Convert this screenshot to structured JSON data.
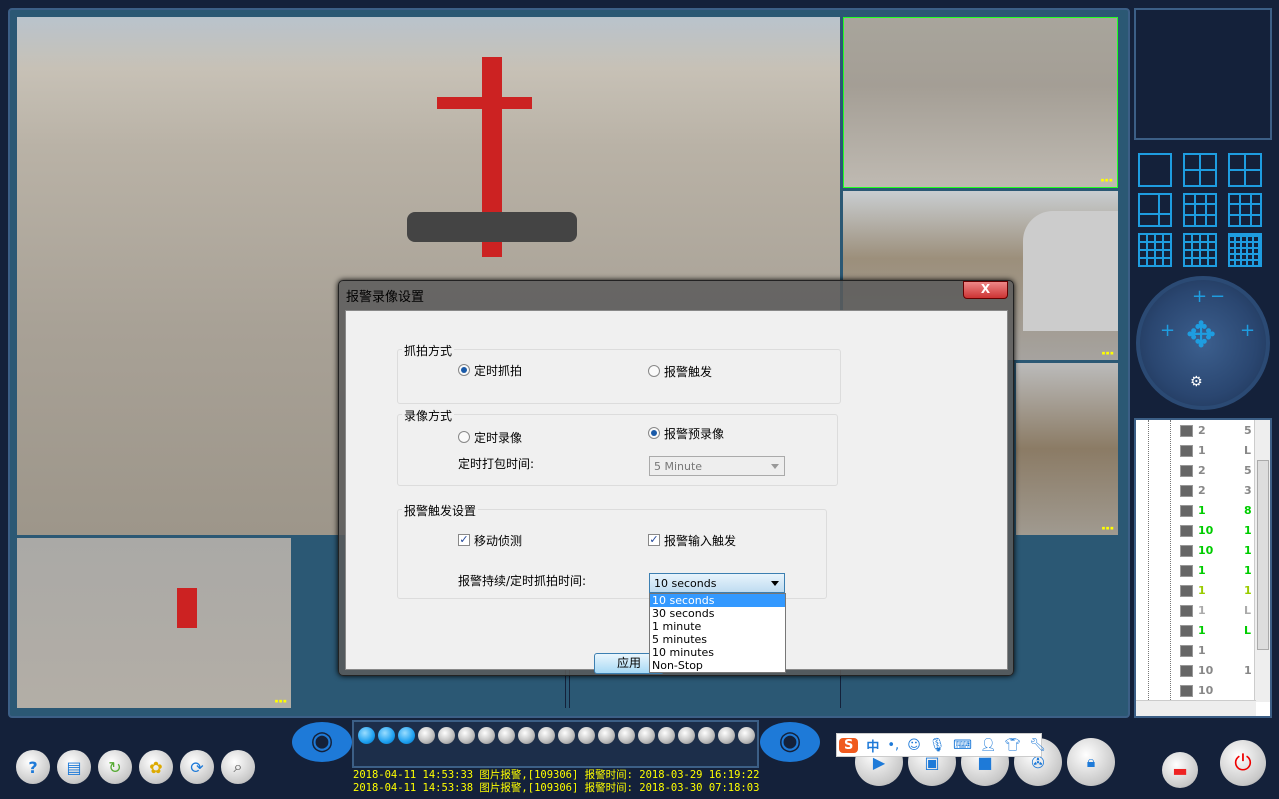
{
  "cameras": {
    "timestamp_label": "录像"
  },
  "dialog": {
    "title": "报警录像设置",
    "close": "X",
    "capture_group": {
      "label": "抓拍方式",
      "options": [
        "定时抓拍",
        "报警触发"
      ],
      "selected": "定时抓拍"
    },
    "record_group": {
      "label": "录像方式",
      "options": [
        "定时录像",
        "报警预录像"
      ],
      "selected": "报警预录像",
      "pack_label": "定时打包时间:",
      "pack_value": "5 Minute"
    },
    "trigger_group": {
      "label": "报警触发设置",
      "motion": "移动侦测",
      "motion_checked": true,
      "input": "报警输入触发",
      "input_checked": true,
      "duration_label": "报警持续/定时抓拍时间:",
      "duration_value": "10 seconds"
    },
    "dropdown_options": [
      "10 seconds",
      "30 seconds",
      "1 minute",
      "5 minutes",
      "10 minutes",
      "Non-Stop"
    ],
    "apply": "应用"
  },
  "tree": {
    "rows": [
      {
        "a": "2",
        "b": "5",
        "color": "#888"
      },
      {
        "a": "1",
        "b": "L",
        "color": "#888"
      },
      {
        "a": "2",
        "b": "5",
        "color": "#888"
      },
      {
        "a": "2",
        "b": "3",
        "color": "#888"
      },
      {
        "a": "1",
        "b": "8",
        "color": "#0c0"
      },
      {
        "a": "10",
        "b": "1",
        "color": "#0c0"
      },
      {
        "a": "10",
        "b": "1",
        "color": "#0c0"
      },
      {
        "a": "1",
        "b": "1",
        "color": "#0c0"
      },
      {
        "a": "1",
        "b": "1",
        "color": "#9c0"
      },
      {
        "a": "1",
        "b": "L",
        "color": "#aaa"
      },
      {
        "a": "1",
        "b": "L",
        "color": "#0c0"
      },
      {
        "a": "1",
        "b": "",
        "color": "#888"
      },
      {
        "a": "10",
        "b": "1",
        "color": "#888"
      },
      {
        "a": "10",
        "b": "",
        "color": "#888"
      }
    ]
  },
  "channels": {
    "active": 3,
    "total": 20,
    "active_color": "#1ea0f0"
  },
  "log": [
    "2018-04-11 14:53:33 图片报警,[109306] 报警时间: 2018-03-29 16:19:22",
    "2018-04-11 14:53:38 图片报警,[109306] 报警时间: 2018-03-30 07:18:03"
  ],
  "ime": {
    "logo": "S",
    "mode": "中",
    "punct": "•,",
    "icons": [
      "smiley-icon",
      "microphone-icon",
      "keyboard-icon",
      "user-icon",
      "shirt-icon",
      "wrench-icon"
    ]
  },
  "toolbar_left": [
    "help-icon",
    "document-icon",
    "refresh-icon",
    "settings-icon",
    "sync-icon",
    "search-icon"
  ],
  "toolbar_right": [
    "play-icon",
    "camera-icon",
    "screen-icon",
    "film-icon",
    "lock-icon"
  ],
  "ptz": {
    "plus": "+",
    "minus": "−"
  }
}
